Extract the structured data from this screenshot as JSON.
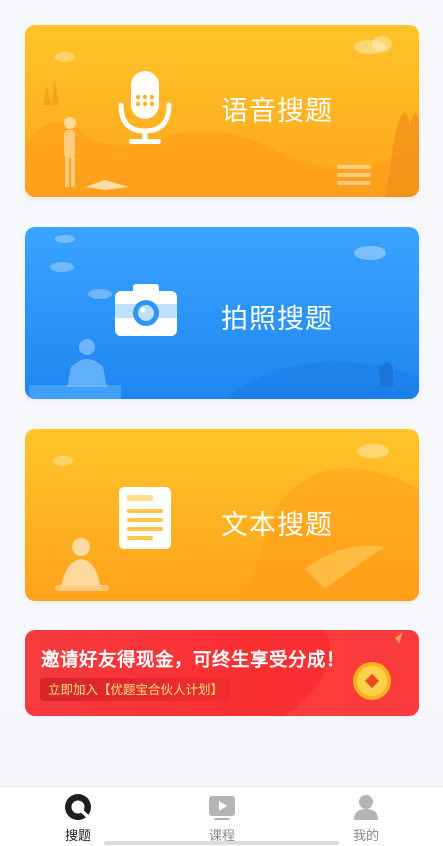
{
  "cards": [
    {
      "label": "语音搜题",
      "icon": "microphone-icon"
    },
    {
      "label": "拍照搜题",
      "icon": "camera-icon"
    },
    {
      "label": "文本搜题",
      "icon": "document-icon"
    }
  ],
  "banner": {
    "title": "邀请好友得现金，可终生享受分成！",
    "subtitle": "立即加入【优题宝合伙人计划】",
    "icon": "gold-coin-icon"
  },
  "tabbar": {
    "items": [
      {
        "label": "搜题",
        "icon": "search-tab-icon",
        "active": true
      },
      {
        "label": "课程",
        "icon": "play-video-icon",
        "active": false
      },
      {
        "label": "我的",
        "icon": "user-profile-icon",
        "active": false
      }
    ]
  },
  "colors": {
    "voice_card": "#ffb323",
    "photo_card": "#2b95fa",
    "text_card": "#ffb323",
    "banner": "#f7333a",
    "active_tab": "#222222",
    "inactive_tab": "#8a8a8a"
  }
}
